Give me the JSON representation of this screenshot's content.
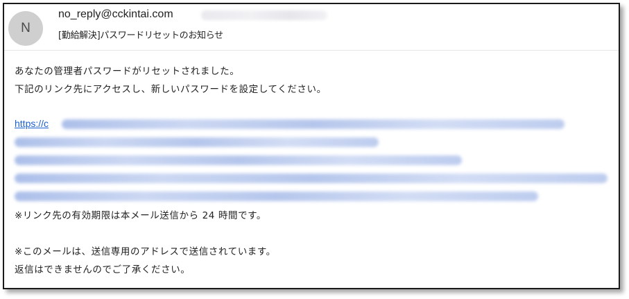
{
  "email": {
    "avatar_letter": "N",
    "sender": "no_reply@cckintai.com",
    "subject": "[勤給解決]パスワードリセットのお知らせ"
  },
  "message": {
    "line1": "あなたの管理者パスワードがリセットされました。",
    "line2": "下記のリンク先にアクセスし、新しいパスワードを設定してください。",
    "link_prefix": "https://c",
    "expiry_note": "※リンク先の有効期限は本メール送信から 24 時間です。",
    "notice1": "※このメールは、送信専用のアドレスで送信されています。",
    "notice2": "返信はできませんのでご了承ください。"
  },
  "colors": {
    "link": "#1a5fd0",
    "avatar_bg": "#cfcfcf",
    "frame_border": "#1a1a1a"
  }
}
